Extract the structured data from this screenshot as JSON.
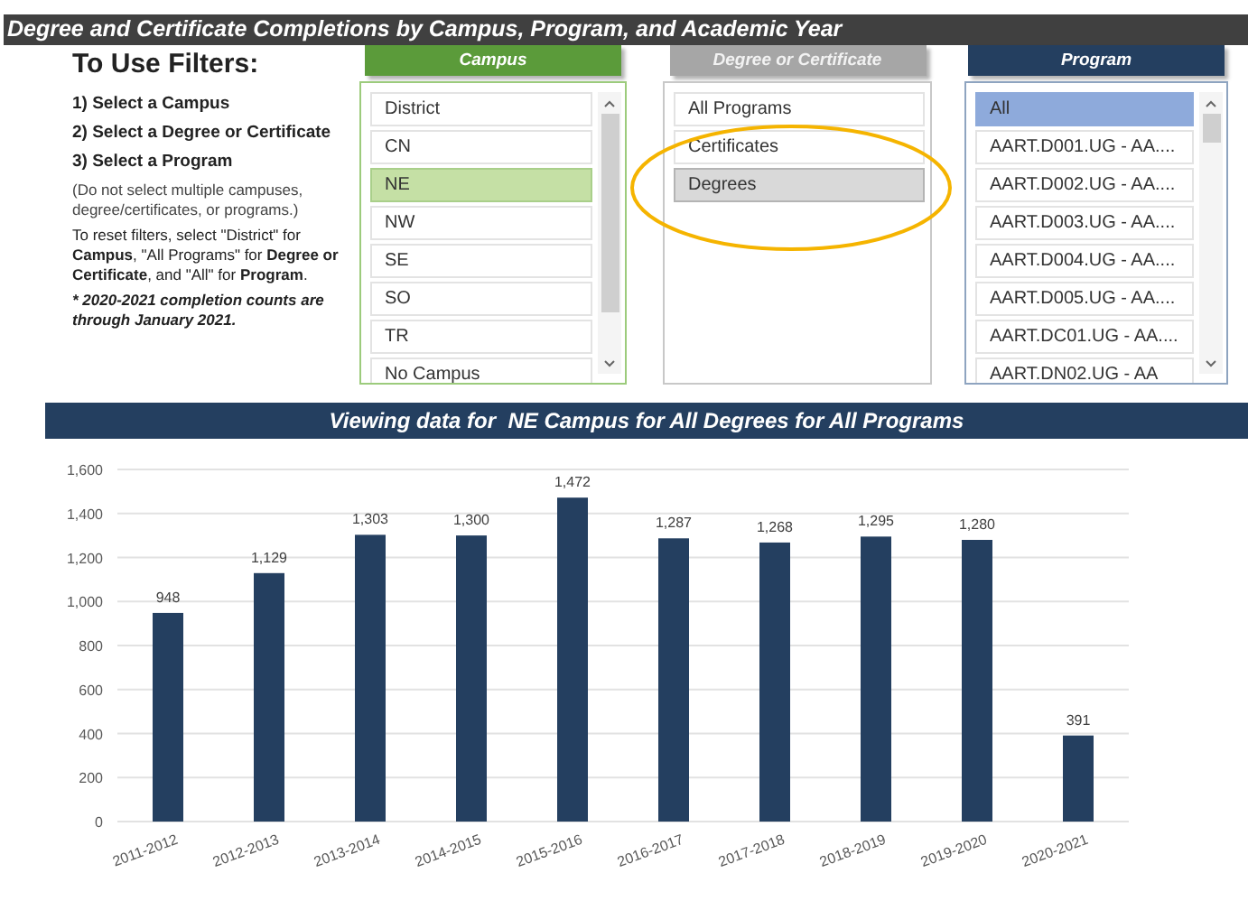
{
  "title": "Degree and Certificate Completions by Campus, Program, and Academic Year",
  "instructions": {
    "heading": "To Use Filters:",
    "steps": [
      "1) Select a Campus",
      "2) Select a Degree or Certificate",
      "3) Select a Program"
    ],
    "note": "(Do not select multiple campuses, degree/certificates, or programs.)",
    "reset": "To reset filters, select \"District\" for **Campus**, \"All Programs\" for **Degree or Certificate**, and \"All\" for **Program**.",
    "footnote": "* 2020-2021 completion counts are through January 2021."
  },
  "slicers": [
    {
      "kind": "campus",
      "header": "Campus",
      "scrollable": true,
      "items": [
        {
          "label": "District",
          "selected": false
        },
        {
          "label": "CN",
          "selected": false
        },
        {
          "label": "NE",
          "selected": true
        },
        {
          "label": "NW",
          "selected": false
        },
        {
          "label": "SE",
          "selected": false
        },
        {
          "label": "SO",
          "selected": false
        },
        {
          "label": "TR",
          "selected": false
        },
        {
          "label": "No Campus",
          "selected": false
        }
      ]
    },
    {
      "kind": "degree",
      "header": "Degree or Certificate",
      "scrollable": false,
      "items": [
        {
          "label": "All Programs",
          "selected": false
        },
        {
          "label": "Certificates",
          "selected": false
        },
        {
          "label": "Degrees",
          "selected": true
        }
      ]
    },
    {
      "kind": "program",
      "header": "Program",
      "scrollable": true,
      "items": [
        {
          "label": "All",
          "selected": true
        },
        {
          "label": "AART.D001.UG - AA....",
          "selected": false
        },
        {
          "label": "AART.D002.UG - AA....",
          "selected": false
        },
        {
          "label": "AART.D003.UG - AA....",
          "selected": false
        },
        {
          "label": "AART.D004.UG - AA....",
          "selected": false
        },
        {
          "label": "AART.D005.UG - AA....",
          "selected": false
        },
        {
          "label": "AART.DC01.UG - AA....",
          "selected": false
        },
        {
          "label": "AART.DN02.UG - AA",
          "selected": false
        }
      ]
    }
  ],
  "chart_banner": "Viewing data for  NE Campus for All Degrees for All Programs",
  "chart_data": {
    "type": "bar",
    "categories": [
      "2011-2012",
      "2012-2013",
      "2013-2014",
      "2014-2015",
      "2015-2016",
      "2016-2017",
      "2017-2018",
      "2018-2019",
      "2019-2020",
      "2020-2021"
    ],
    "series": [
      {
        "color": "#243f60",
        "values": [
          948,
          1129,
          1303,
          1300,
          1472,
          1287,
          1268,
          1295,
          1280,
          391
        ]
      }
    ],
    "ylim": [
      0,
      1600
    ],
    "yticks": [
      {
        "value": 0,
        "label": "0"
      },
      {
        "value": 200,
        "label": "200"
      },
      {
        "value": 400,
        "label": "400"
      },
      {
        "value": 600,
        "label": "600"
      },
      {
        "value": 800,
        "label": "800"
      },
      {
        "value": 1000,
        "label": "1,000"
      },
      {
        "value": 1200,
        "label": "1,200"
      },
      {
        "value": 1400,
        "label": "1,400"
      },
      {
        "value": 1600,
        "label": "1,600"
      }
    ],
    "grid": true,
    "value_labels": [
      "948",
      "1,129",
      "1,303",
      "1,300",
      "1,472",
      "1,287",
      "1,268",
      "1,295",
      "1,280",
      "391"
    ]
  }
}
